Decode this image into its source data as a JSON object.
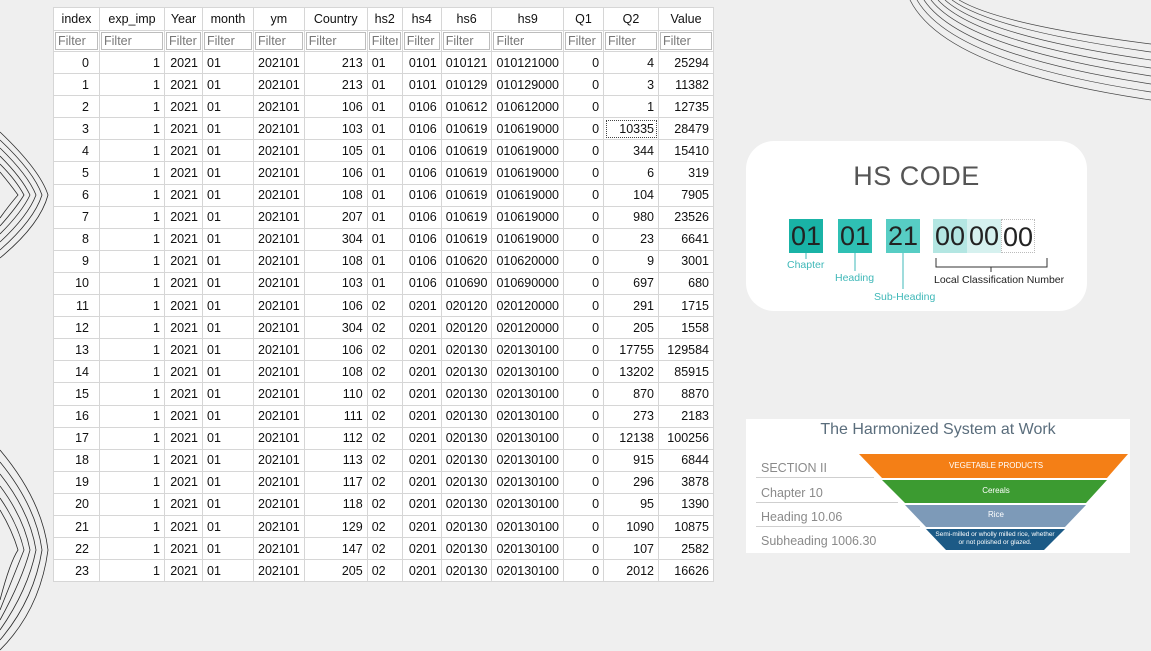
{
  "table": {
    "columns": [
      {
        "key": "index",
        "label": "index",
        "width": 46
      },
      {
        "key": "exp_imp",
        "label": "exp_imp",
        "width": 65
      },
      {
        "key": "Year",
        "label": "Year",
        "width": 38
      },
      {
        "key": "month",
        "label": "month",
        "width": 51
      },
      {
        "key": "ym",
        "label": "ym",
        "width": 48
      },
      {
        "key": "Country",
        "label": "Country",
        "width": 63
      },
      {
        "key": "hs2",
        "label": "hs2",
        "width": 35
      },
      {
        "key": "hs4",
        "label": "hs4",
        "width": 39
      },
      {
        "key": "hs6",
        "label": "hs6",
        "width": 50
      },
      {
        "key": "hs9",
        "label": "hs9",
        "width": 71
      },
      {
        "key": "Q1",
        "label": "Q1",
        "width": 40
      },
      {
        "key": "Q2",
        "label": "Q2",
        "width": 55
      },
      {
        "key": "Value",
        "label": "Value",
        "width": 55
      }
    ],
    "filter_placeholder": "Filter",
    "selected_cell": {
      "row": 3,
      "column": "Q2"
    },
    "rows": [
      [
        "0",
        "1",
        "2021",
        "01",
        "202101",
        "213",
        "01",
        "0101",
        "010121",
        "010121000",
        "0",
        "4",
        "25294"
      ],
      [
        "1",
        "1",
        "2021",
        "01",
        "202101",
        "213",
        "01",
        "0101",
        "010129",
        "010129000",
        "0",
        "3",
        "11382"
      ],
      [
        "2",
        "1",
        "2021",
        "01",
        "202101",
        "106",
        "01",
        "0106",
        "010612",
        "010612000",
        "0",
        "1",
        "12735"
      ],
      [
        "3",
        "1",
        "2021",
        "01",
        "202101",
        "103",
        "01",
        "0106",
        "010619",
        "010619000",
        "0",
        "10335",
        "28479"
      ],
      [
        "4",
        "1",
        "2021",
        "01",
        "202101",
        "105",
        "01",
        "0106",
        "010619",
        "010619000",
        "0",
        "344",
        "15410"
      ],
      [
        "5",
        "1",
        "2021",
        "01",
        "202101",
        "106",
        "01",
        "0106",
        "010619",
        "010619000",
        "0",
        "6",
        "319"
      ],
      [
        "6",
        "1",
        "2021",
        "01",
        "202101",
        "108",
        "01",
        "0106",
        "010619",
        "010619000",
        "0",
        "104",
        "7905"
      ],
      [
        "7",
        "1",
        "2021",
        "01",
        "202101",
        "207",
        "01",
        "0106",
        "010619",
        "010619000",
        "0",
        "980",
        "23526"
      ],
      [
        "8",
        "1",
        "2021",
        "01",
        "202101",
        "304",
        "01",
        "0106",
        "010619",
        "010619000",
        "0",
        "23",
        "6641"
      ],
      [
        "9",
        "1",
        "2021",
        "01",
        "202101",
        "108",
        "01",
        "0106",
        "010620",
        "010620000",
        "0",
        "9",
        "3001"
      ],
      [
        "10",
        "1",
        "2021",
        "01",
        "202101",
        "103",
        "01",
        "0106",
        "010690",
        "010690000",
        "0",
        "697",
        "680"
      ],
      [
        "11",
        "1",
        "2021",
        "01",
        "202101",
        "106",
        "02",
        "0201",
        "020120",
        "020120000",
        "0",
        "291",
        "1715"
      ],
      [
        "12",
        "1",
        "2021",
        "01",
        "202101",
        "304",
        "02",
        "0201",
        "020120",
        "020120000",
        "0",
        "205",
        "1558"
      ],
      [
        "13",
        "1",
        "2021",
        "01",
        "202101",
        "106",
        "02",
        "0201",
        "020130",
        "020130100",
        "0",
        "17755",
        "129584"
      ],
      [
        "14",
        "1",
        "2021",
        "01",
        "202101",
        "108",
        "02",
        "0201",
        "020130",
        "020130100",
        "0",
        "13202",
        "85915"
      ],
      [
        "15",
        "1",
        "2021",
        "01",
        "202101",
        "110",
        "02",
        "0201",
        "020130",
        "020130100",
        "0",
        "870",
        "8870"
      ],
      [
        "16",
        "1",
        "2021",
        "01",
        "202101",
        "111",
        "02",
        "0201",
        "020130",
        "020130100",
        "0",
        "273",
        "2183"
      ],
      [
        "17",
        "1",
        "2021",
        "01",
        "202101",
        "112",
        "02",
        "0201",
        "020130",
        "020130100",
        "0",
        "12138",
        "100256"
      ],
      [
        "18",
        "1",
        "2021",
        "01",
        "202101",
        "113",
        "02",
        "0201",
        "020130",
        "020130100",
        "0",
        "915",
        "6844"
      ],
      [
        "19",
        "1",
        "2021",
        "01",
        "202101",
        "117",
        "02",
        "0201",
        "020130",
        "020130100",
        "0",
        "296",
        "3878"
      ],
      [
        "20",
        "1",
        "2021",
        "01",
        "202101",
        "118",
        "02",
        "0201",
        "020130",
        "020130100",
        "0",
        "95",
        "1390"
      ],
      [
        "21",
        "1",
        "2021",
        "01",
        "202101",
        "129",
        "02",
        "0201",
        "020130",
        "020130100",
        "0",
        "1090",
        "10875"
      ],
      [
        "22",
        "1",
        "2021",
        "01",
        "202101",
        "147",
        "02",
        "0201",
        "020130",
        "020130100",
        "0",
        "107",
        "2582"
      ],
      [
        "23",
        "1",
        "2021",
        "01",
        "202101",
        "205",
        "02",
        "0201",
        "020130",
        "020130100",
        "0",
        "2012",
        "16626"
      ]
    ]
  },
  "hs_code_card": {
    "title": "HS CODE",
    "digits": [
      "01",
      "01",
      "21",
      "00",
      "00",
      "00"
    ],
    "labels": {
      "chapter": "Chapter",
      "heading": "Heading",
      "sub_heading": "Sub-Heading",
      "local": "Local Classification Number"
    },
    "colors": {
      "chapter": "#19b3a6",
      "heading": "#2fc0b4",
      "sub_heading": "#57cdc4",
      "local1": "#b3e6e2",
      "local2": "#d6f1ef",
      "accent_text": "#3fb8b8"
    }
  },
  "harmonized": {
    "title": "The Harmonized System at Work",
    "rows": [
      {
        "label": "SECTION II",
        "band": "VEGETABLE PRODUCTS",
        "color": "#f47f16"
      },
      {
        "label": "Chapter 10",
        "band": "Cereals",
        "color": "#3c9b31"
      },
      {
        "label": "Heading 10.06",
        "band": "Rice",
        "color": "#7d9ab8"
      },
      {
        "label": "Subheading 1006.30",
        "band": "Semi-milled or wholly milled rice, whether or not polished or glazed.",
        "color": "#1c5a86"
      }
    ]
  }
}
